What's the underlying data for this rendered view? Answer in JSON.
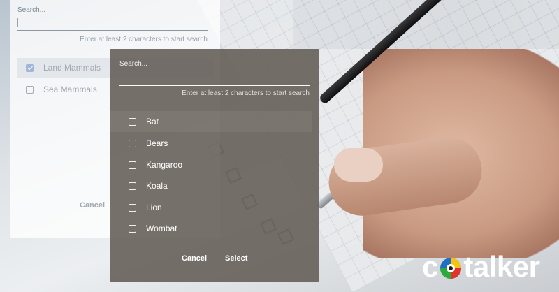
{
  "back_dialog": {
    "search_label": "Search...",
    "hint": "Enter at least 2 characters to start search",
    "options": [
      {
        "label": "Land Mammals",
        "checked": true
      },
      {
        "label": "Sea Mammals",
        "checked": false
      }
    ],
    "cancel_label": "Cancel"
  },
  "front_dialog": {
    "search_label": "Search...",
    "hint": "Enter at least 2 characters to start search",
    "options": [
      {
        "label": "Bat",
        "checked": false
      },
      {
        "label": "Bears",
        "checked": false
      },
      {
        "label": "Kangaroo",
        "checked": false
      },
      {
        "label": "Koala",
        "checked": false
      },
      {
        "label": "Lion",
        "checked": false
      },
      {
        "label": "Wombat",
        "checked": false
      }
    ],
    "cancel_label": "Cancel",
    "select_label": "Select"
  },
  "brand": {
    "prefix": "c",
    "suffix": "talker",
    "logo_icon": "cotalker-o-logo",
    "colors": {
      "yellow": "#f6c313",
      "red": "#e2332b",
      "green": "#2eaa3c",
      "blue": "#1f6fc4"
    }
  }
}
